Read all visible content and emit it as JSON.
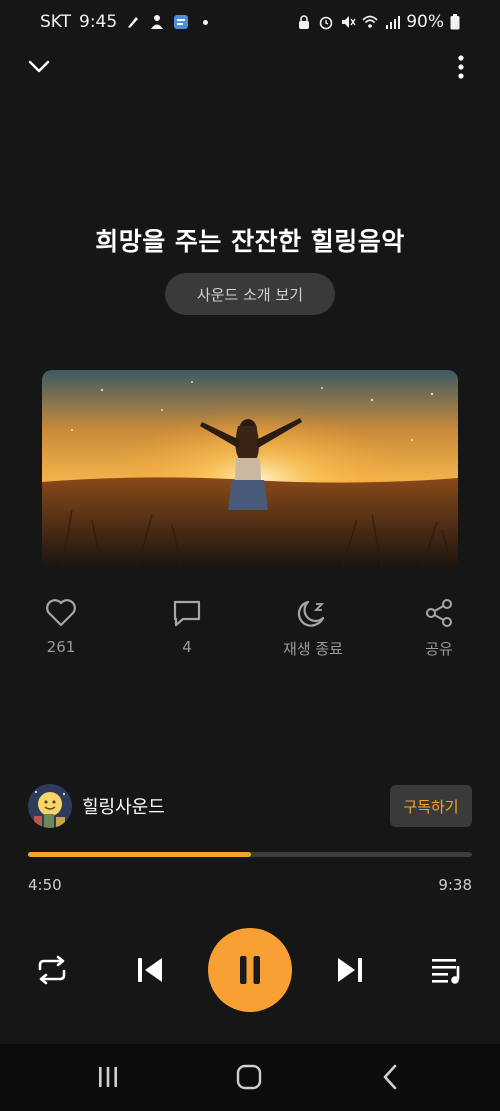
{
  "status_bar": {
    "carrier": "SKT",
    "time": "9:45",
    "battery": "90%"
  },
  "player": {
    "title": "희망을 주는 잔잔한 힐링음악",
    "intro_button": "사운드 소개 보기"
  },
  "actions": {
    "like_count": "261",
    "comment_count": "4",
    "sleep_label": "재생 종료",
    "share_label": "공유"
  },
  "channel": {
    "name": "힐링사운드",
    "subscribe_label": "구독하기"
  },
  "progress": {
    "current": "4:50",
    "total": "9:38",
    "fraction": 0.503
  },
  "colors": {
    "accent": "#f8a033",
    "background": "#161616"
  },
  "icons": {
    "collapse": "chevron-down-icon",
    "more": "more-vertical-icon",
    "like": "heart-icon",
    "comment": "comment-icon",
    "sleep": "moon-sleep-icon",
    "share": "share-icon",
    "repeat": "repeat-icon",
    "previous": "skip-previous-icon",
    "pause": "pause-icon",
    "next": "skip-next-icon",
    "playlist": "playlist-icon"
  }
}
